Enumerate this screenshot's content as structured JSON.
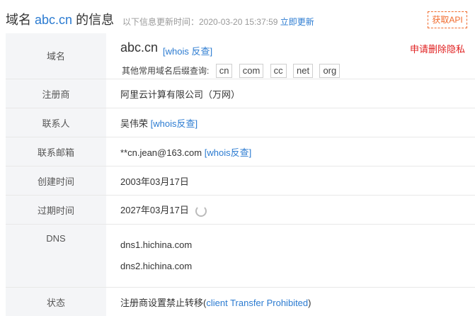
{
  "header": {
    "title_prefix": "域名",
    "domain": "abc.cn",
    "title_suffix": "的信息",
    "update_label": "以下信息更新时间：2020-03-20 15:37:59",
    "update_link": "立即更新",
    "api_button": "获取API"
  },
  "domain_row": {
    "label": "域名",
    "name": "abc.cn",
    "whois_link": "[whois 反查]",
    "privacy_link": "申请删除隐私",
    "suffix_label": "其他常用域名后缀查询:",
    "suffixes": [
      "cn",
      "com",
      "cc",
      "net",
      "org"
    ]
  },
  "rows": {
    "registrar": {
      "label": "注册商",
      "value": "阿里云计算有限公司（万网）"
    },
    "contact": {
      "label": "联系人",
      "value": "吴伟荣",
      "link": "[whois反查]"
    },
    "email": {
      "label": "联系邮箱",
      "value": "**cn.jean@163.com",
      "link": "[whois反查]"
    },
    "created": {
      "label": "创建时间",
      "value": "2003年03月17日"
    },
    "expires": {
      "label": "过期时间",
      "value": "2027年03月17日",
      "icon": "refresh-icon"
    },
    "dns": {
      "label": "DNS",
      "values": [
        "dns1.hichina.com",
        "dns2.hichina.com"
      ]
    },
    "status": {
      "label": "状态",
      "prefix": "注册商设置禁止转移(",
      "link": "client Transfer Prohibited",
      "suffix": ")"
    }
  },
  "colors": {
    "link": "#2b7bd1",
    "accent": "#f06a2c",
    "warning": "#e02020",
    "label_bg": "#f4f5f7"
  }
}
